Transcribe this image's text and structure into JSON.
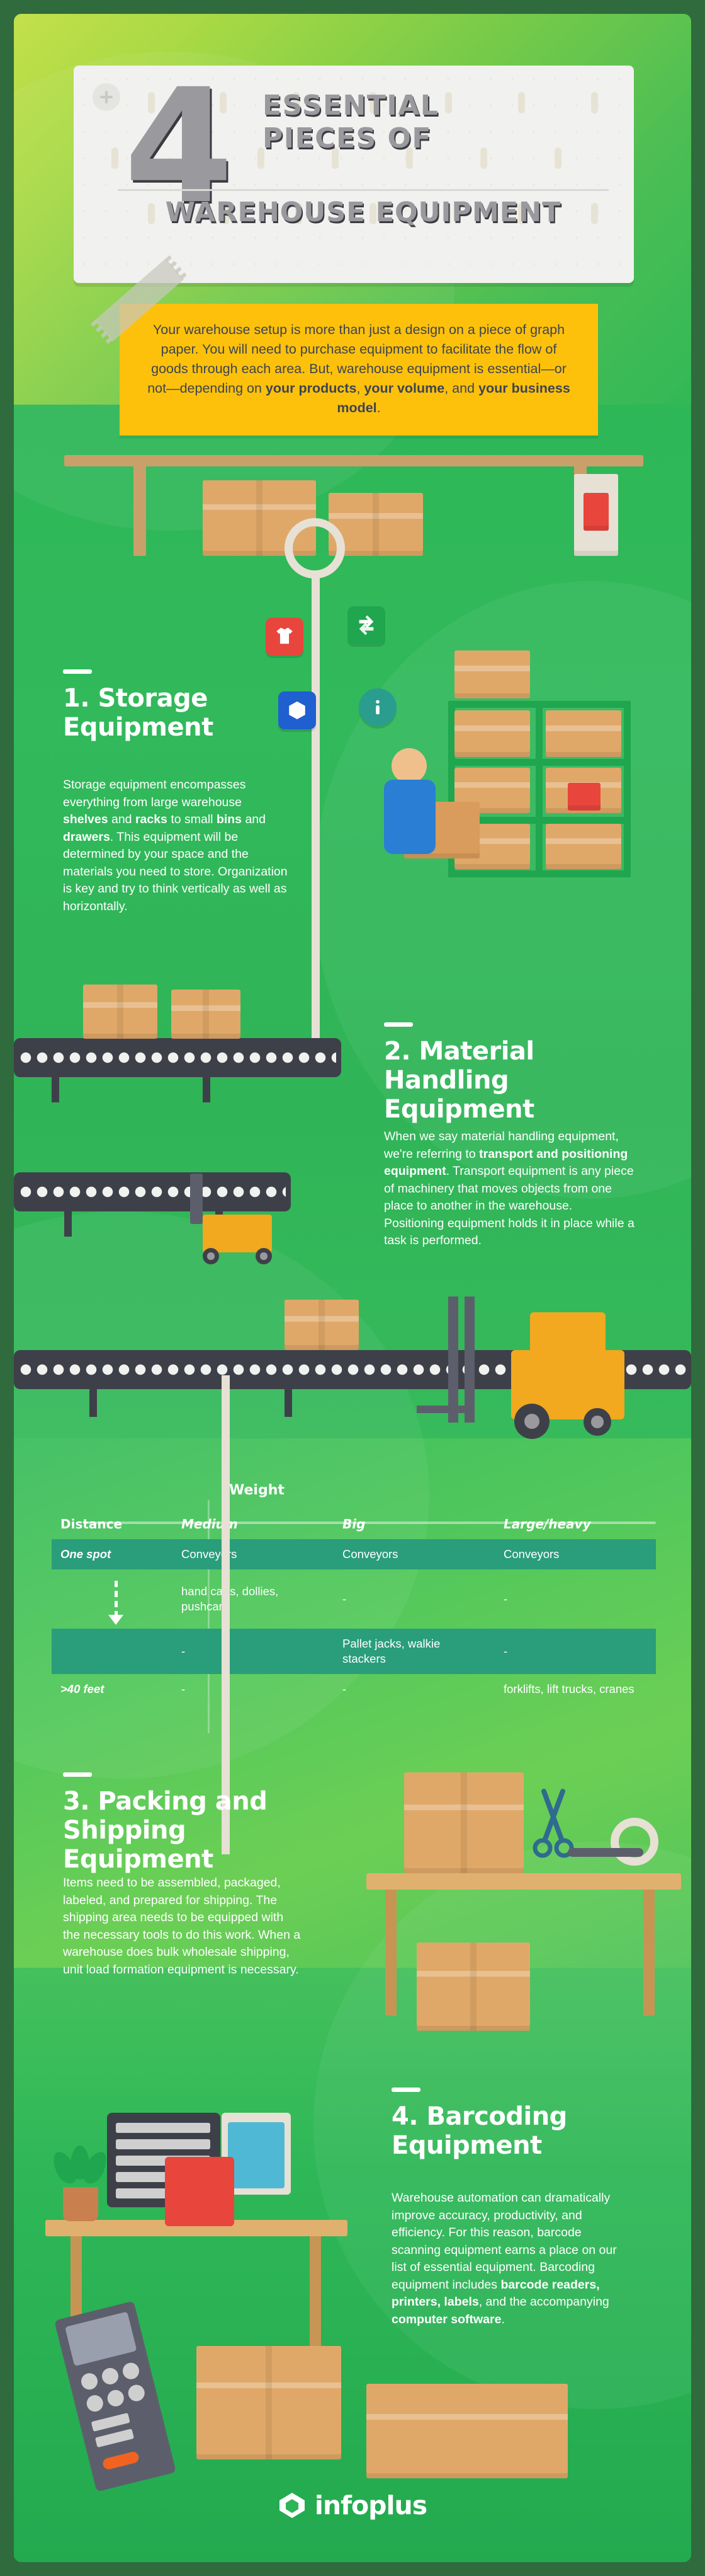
{
  "header": {
    "number": "4",
    "title_line1": "ESSENTIAL",
    "title_line2": "PIECES OF",
    "title_line3": "WAREHOUSE EQUIPMENT",
    "note_html": "Your warehouse setup is more than just a design on a piece of graph paper. You will need to purchase equipment to facilitate the flow of goods through each area. But, warehouse equipment is essential—or not—depending on <b>your products</b>, <b>your volume</b>, and <b>your business model</b>."
  },
  "sections": [
    {
      "number": "1.",
      "title_line1": "1. Storage",
      "title_line2": "Equipment",
      "body_html": "Storage equipment encompasses everything from large warehouse <b>shelves</b> and <b>racks</b> to small <b>bins</b> and <b>drawers</b>. This equipment will be determined by your space and the materials you need to store. Organization is key and try to think vertically as well as horizontally."
    },
    {
      "number": "2.",
      "title_line1": "2. Material Handling",
      "title_line2": "Equipment",
      "body_html": "When we say material handling equipment, we're referring to <b>transport and positioning equipment</b>. Transport equipment is any piece of machinery that moves objects from one place to another in the warehouse. Positioning equipment holds it in place while a task is performed."
    },
    {
      "number": "3.",
      "title_line1": "3. Packing and",
      "title_line2": "Shipping Equipment",
      "body_html": "Items need to be assembled, packaged, labeled, and prepared for shipping. The shipping area needs to be equipped with the necessary tools to do this work. When a warehouse does bulk wholesale shipping, unit load formation equipment is necessary."
    },
    {
      "number": "4.",
      "title_line1": "4. Barcoding",
      "title_line2": "Equipment",
      "body_html": "Warehouse automation can dramatically improve accuracy, productivity, and efficiency. For this reason, barcode scanning equipment earns a place on our list of essential equipment. Barcoding equipment includes <b>barcode readers, printers, labels</b>, and the accompanying <b>computer software</b>."
    }
  ],
  "table": {
    "weight_label": "Weight",
    "headers": [
      "Distance",
      "Medium",
      "Big",
      "Large/heavy"
    ],
    "rows": [
      {
        "distance": "One spot",
        "medium": "Conveyors",
        "big": "Conveyors",
        "large": "Conveyors",
        "highlight": true
      },
      {
        "distance": "",
        "medium": "hand carts, dollies, pushcart",
        "big": "-",
        "large": "-",
        "highlight": false
      },
      {
        "distance": "",
        "medium": "-",
        "big": "Pallet jacks, walkie stackers",
        "large": "-",
        "highlight": true
      },
      {
        "distance": ">40 feet",
        "medium": "-",
        "big": "-",
        "large": "forklifts, lift trucks, cranes",
        "highlight": false
      }
    ]
  },
  "footer": {
    "brand": "infoplus"
  },
  "colors": {
    "brand_green": "#2fb457",
    "dark_green_border": "#2f6b3c",
    "accent_yellow": "#fdc10c",
    "sign_gray": "#9a9a9e",
    "table_highlight": "#2a9d7a",
    "red_badge": "#e8453c",
    "blue_badge": "#1f5fd0",
    "teal_badge": "#2a9d8f"
  }
}
